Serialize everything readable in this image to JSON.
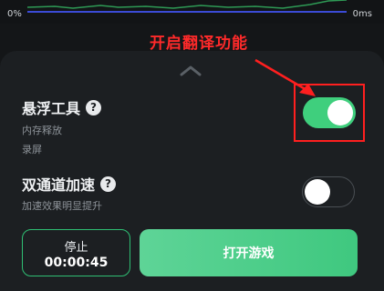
{
  "graph": {
    "left_label": "0%",
    "right_label": "0ms"
  },
  "annotation": {
    "text": "开启翻译功能"
  },
  "settings": {
    "floating_tool": {
      "title": "悬浮工具",
      "subtitles": [
        "内存释放",
        "录屏"
      ],
      "enabled": true
    },
    "dual_channel": {
      "title": "双通道加速",
      "subtitle": "加速效果明显提升",
      "enabled": false
    }
  },
  "actions": {
    "stop_label": "停止",
    "timer": "00:00:45",
    "open_game_label": "打开游戏"
  },
  "colors": {
    "accent": "#3fcf7d",
    "annotation": "#ff2a2a",
    "sheet_bg": "#1c1f22"
  },
  "icons": {
    "help": "question-circle-icon",
    "handle": "chevron-up-icon",
    "arrow": "annotation-arrow-icon"
  }
}
